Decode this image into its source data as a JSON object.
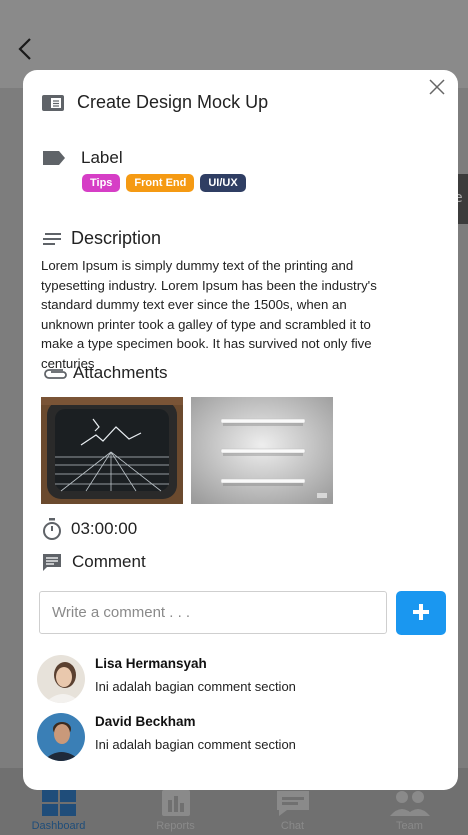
{
  "background": {
    "bottom_nav": [
      {
        "label": "Dashboard",
        "icon": "dashboard-grid-icon",
        "active": true
      },
      {
        "label": "Reports",
        "icon": "reports-chart-icon",
        "active": false
      },
      {
        "label": "Chat",
        "icon": "chat-bubble-icon",
        "active": false
      },
      {
        "label": "Team",
        "icon": "team-people-icon",
        "active": false
      }
    ],
    "right_chip_char": "e"
  },
  "modal": {
    "title": "Create Design Mock Up",
    "label_heading": "Label",
    "labels": [
      {
        "text": "Tips",
        "color": "#d63ec6"
      },
      {
        "text": "Front End",
        "color": "#f59a13"
      },
      {
        "text": "UI/UX",
        "color": "#2f3e63"
      }
    ],
    "description_heading": "Description",
    "description_text": "Lorem Ipsum is simply dummy text of the printing and typesetting industry. Lorem Ipsum has been the industry's standard dummy text ever since the 1500s, when an unknown printer took a galley of type and scrambled it to make a type specimen book. It has survived not only five centuries",
    "attachments_heading": "Attachments",
    "timer": "03:00:00",
    "comment_heading": "Comment",
    "comment_placeholder": "Write a comment . . .",
    "comments": [
      {
        "name": "Lisa Hermansyah",
        "message": "Ini adalah bagian comment section"
      },
      {
        "name": "David Beckham",
        "message": "Ini adalah bagian comment section"
      }
    ]
  },
  "colors": {
    "accent_blue": "#1a97f0",
    "nav_active": "#1f4d7a"
  }
}
